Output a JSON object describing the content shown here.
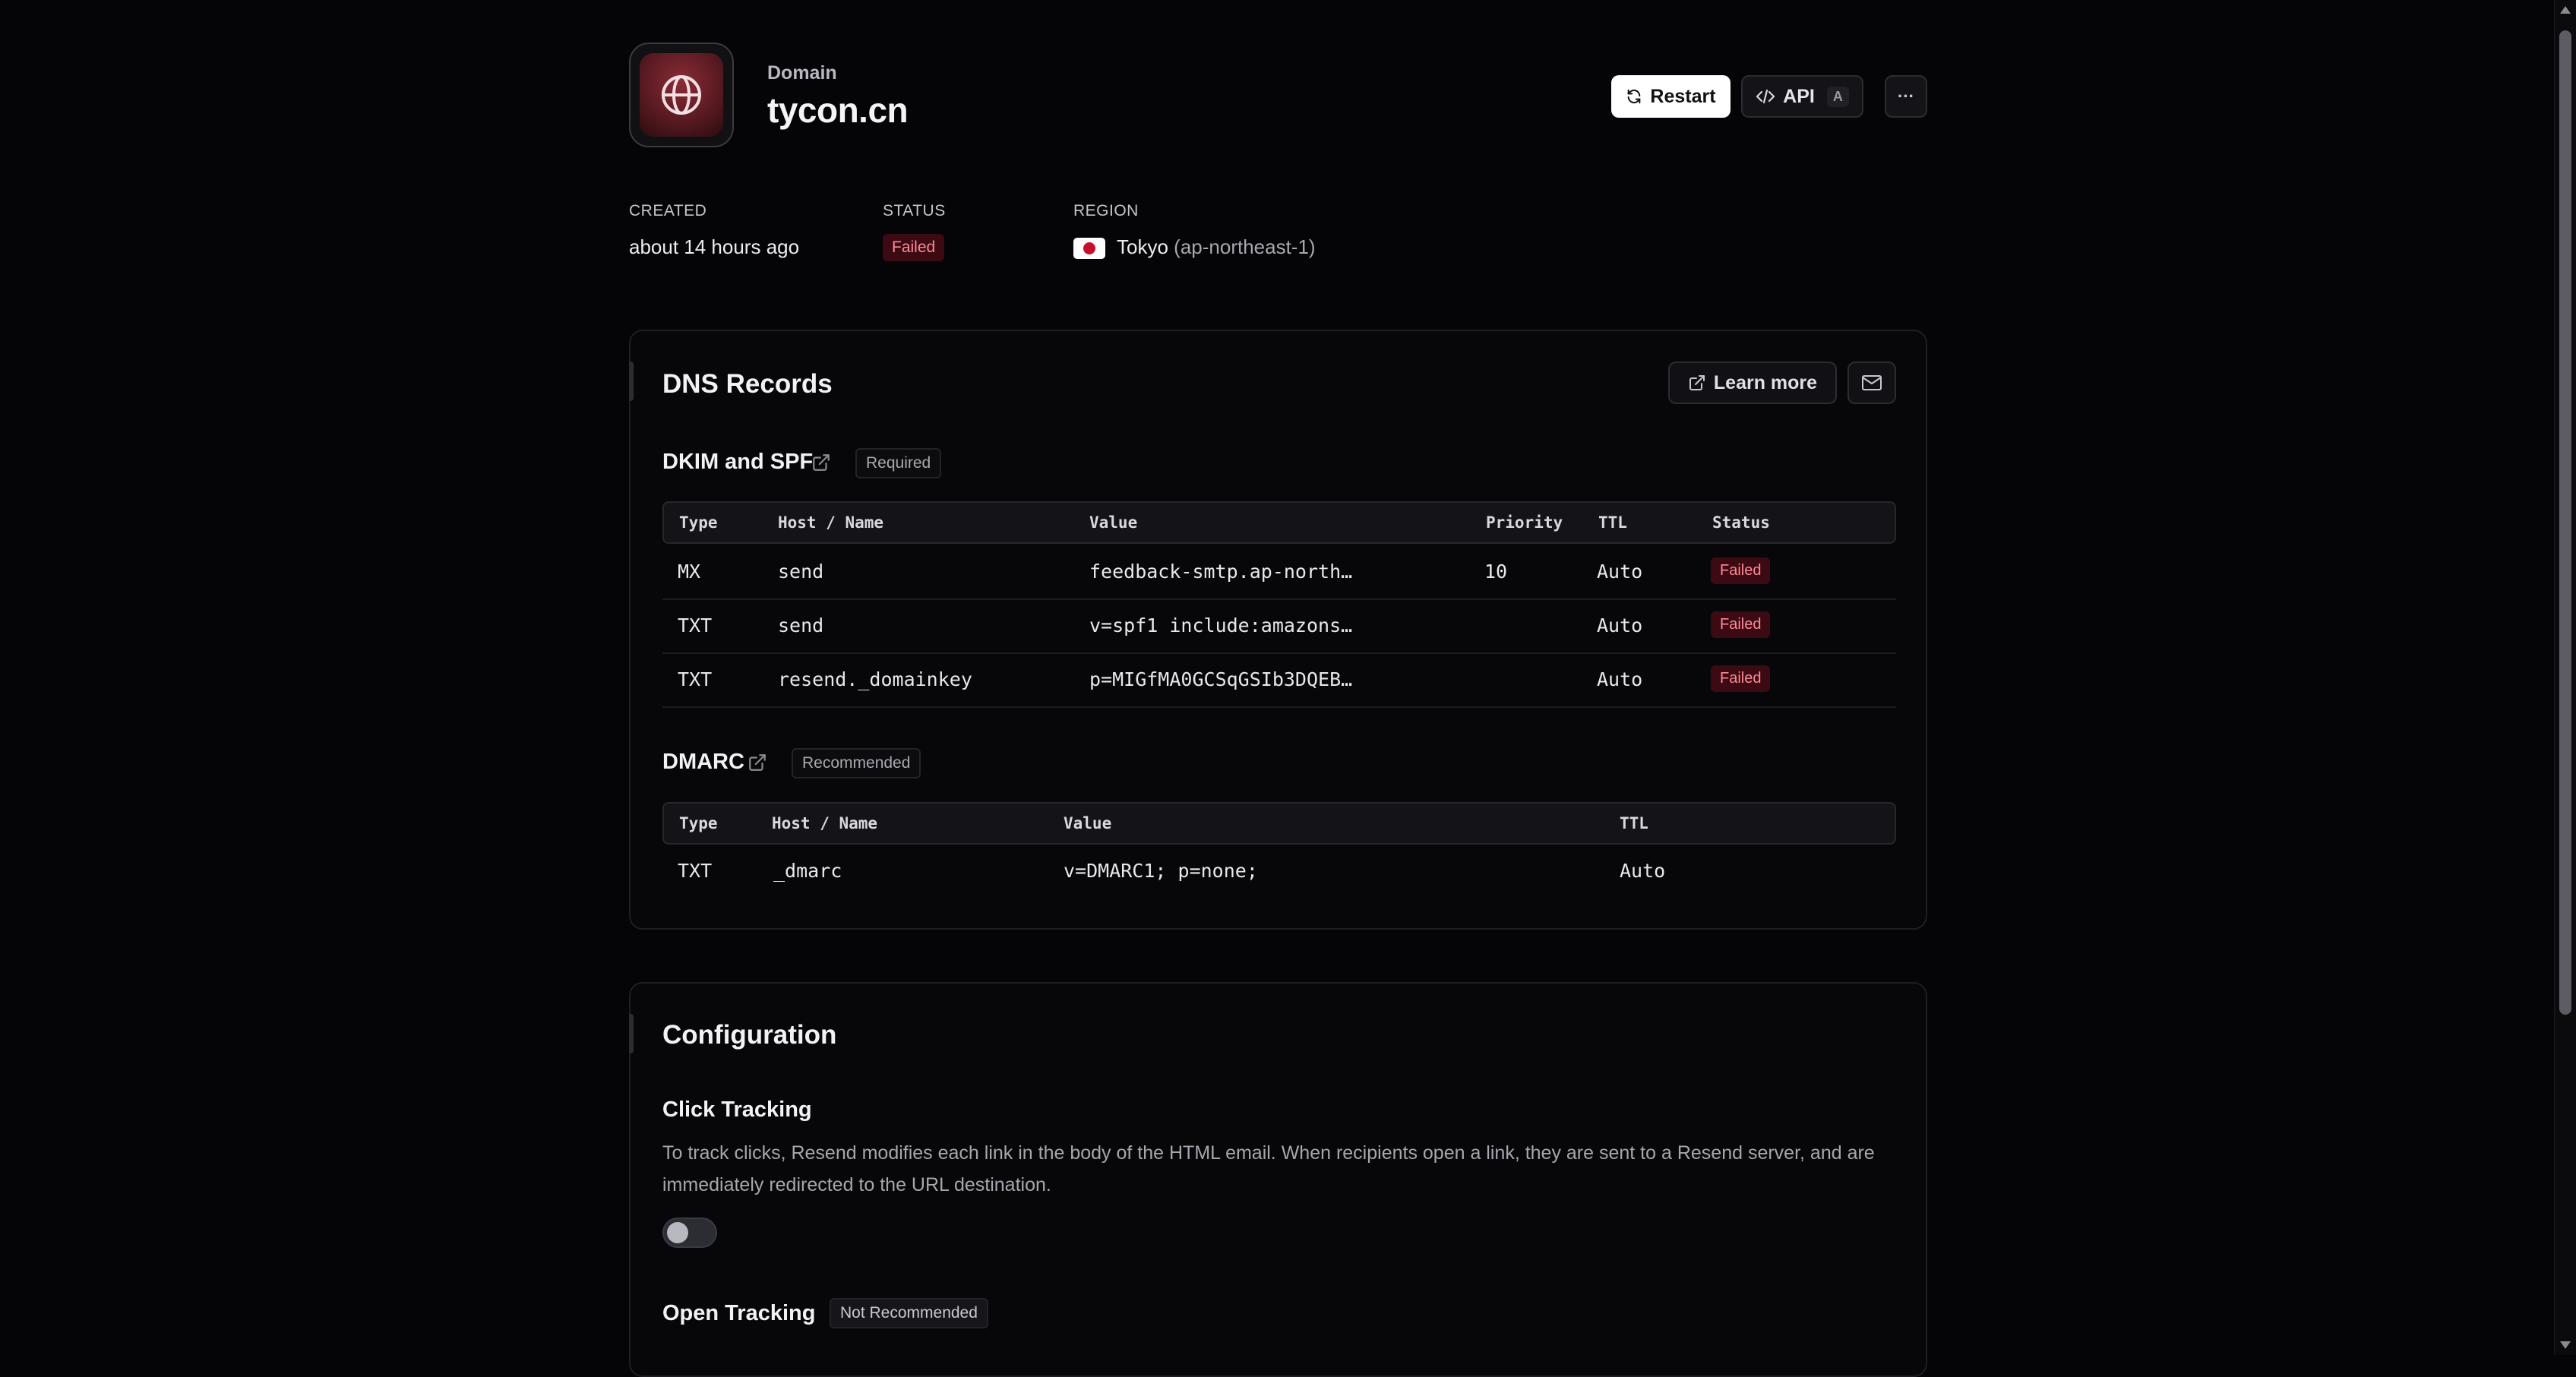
{
  "header": {
    "eyebrow": "Domain",
    "title": "tycon.cn",
    "restart_label": "Restart",
    "api_label": "API",
    "api_shortcut": "A",
    "more_label": "···"
  },
  "meta": {
    "created_label": "CREATED",
    "created_value": "about 14 hours ago",
    "status_label": "STATUS",
    "status_value": "Failed",
    "region_label": "REGION",
    "region_city": "Tokyo",
    "region_code": "(ap-northeast-1)"
  },
  "dns": {
    "title": "DNS Records",
    "learn_more_label": "Learn more",
    "dkim": {
      "title": "DKIM and SPF",
      "tag": "Required",
      "headers": [
        "Type",
        "Host / Name",
        "Value",
        "Priority",
        "TTL",
        "Status"
      ],
      "rows": [
        {
          "type": "MX",
          "host": "send",
          "value": "feedback-smtp.ap-north…",
          "priority": "10",
          "ttl": "Auto",
          "status": "Failed"
        },
        {
          "type": "TXT",
          "host": "send",
          "value": "v=spf1 include:amazons…",
          "priority": "",
          "ttl": "Auto",
          "status": "Failed"
        },
        {
          "type": "TXT",
          "host": "resend._domainkey",
          "value": "p=MIGfMA0GCSqGSIb3DQEB…",
          "priority": "",
          "ttl": "Auto",
          "status": "Failed"
        }
      ]
    },
    "dmarc": {
      "title": "DMARC",
      "tag": "Recommended",
      "headers": [
        "Type",
        "Host / Name",
        "Value",
        "TTL"
      ],
      "rows": [
        {
          "type": "TXT",
          "host": "_dmarc",
          "value": "v=DMARC1; p=none;",
          "ttl": "Auto"
        }
      ]
    }
  },
  "config": {
    "title": "Configuration",
    "click_tracking": {
      "title": "Click Tracking",
      "description": "To track clicks, Resend modifies each link in the body of the HTML email. When recipients open a link, they are sent to a Resend server, and are immediately redirected to the URL destination.",
      "enabled": false
    },
    "open_tracking": {
      "title": "Open Tracking",
      "tag": "Not Recommended"
    }
  },
  "colors": {
    "background": "#050507",
    "failed_badge_bg": "#3b0a12",
    "failed_badge_text": "#ff8a98",
    "brand_red": "#8a2c36"
  },
  "icons": [
    "globe-icon",
    "refresh-icon",
    "code-icon",
    "external-link-icon",
    "mail-icon",
    "japan-flag-icon"
  ]
}
